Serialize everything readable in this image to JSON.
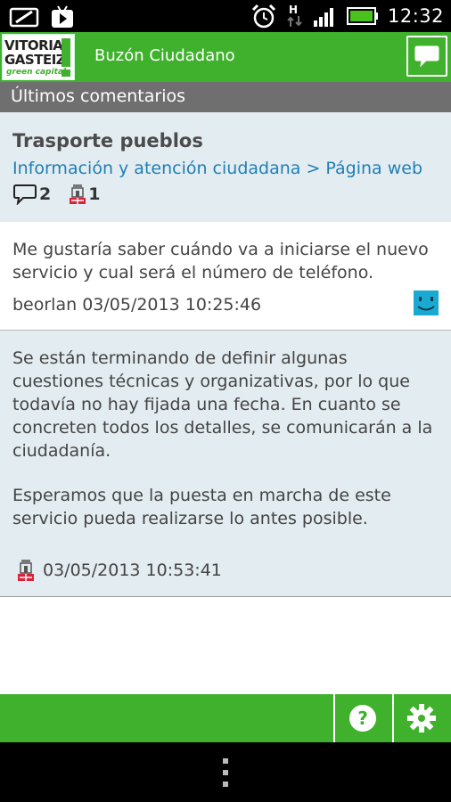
{
  "status": {
    "time": "12:32",
    "network": "H"
  },
  "header": {
    "logo": {
      "line1": "VITORIA",
      "line2": "GASTEIZ",
      "line3": "green capital"
    },
    "title": "Buzón Ciudadano"
  },
  "section": {
    "title": "Últimos comentarios"
  },
  "topic": {
    "title": "Trasporte pueblos",
    "category": "Información y atención ciudadana > Página web",
    "comments_count": "2",
    "official_count": "1"
  },
  "question": {
    "text": "Me gustaría saber cuándo va a iniciarse el nuevo servicio y cual será el número de teléfono.",
    "meta": "beorlan 03/05/2013 10:25:46"
  },
  "answer": {
    "paragraph1": "Se están terminando de definir algunas cuestiones técnicas y organizativas, por lo que todavía no hay fijada una fecha. En cuanto se concreten todos los detalles, se comunicarán a la ciudadanía.",
    "paragraph2": "Esperamos que la puesta en marcha de este servicio pueda realizarse lo antes posible.",
    "meta": "03/05/2013 10:53:41"
  },
  "colors": {
    "brand": "#3fb12c",
    "link": "#1f7fb4",
    "panel": "#e3ecf1",
    "section": "#6f6f6f"
  },
  "icons": [
    "alarm-icon",
    "signal-icon",
    "battery-icon",
    "comment-icon",
    "official-icon",
    "smiley-icon",
    "help-icon",
    "settings-icon",
    "menu-icon"
  ]
}
